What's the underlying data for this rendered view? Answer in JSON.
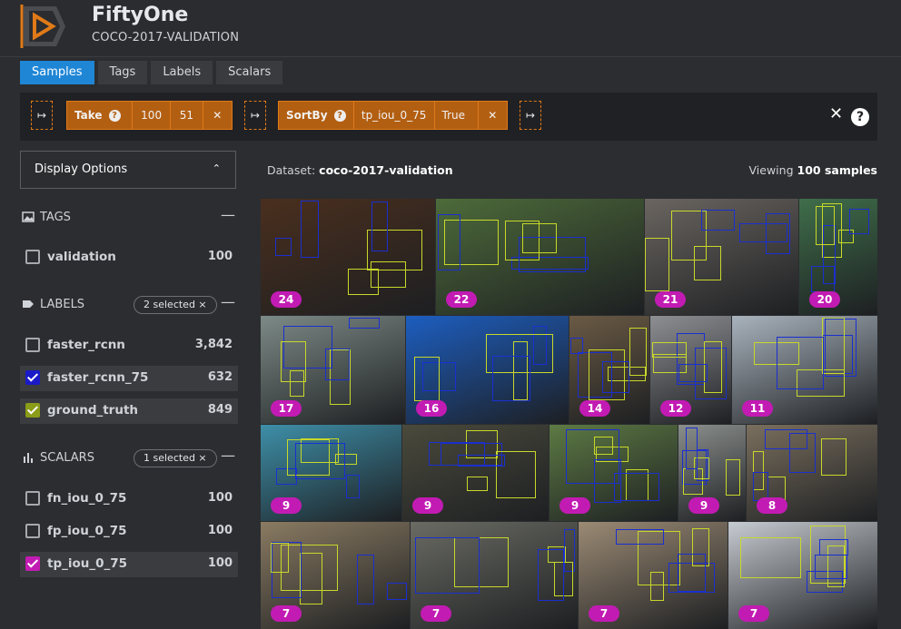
{
  "app": {
    "title": "FiftyOne",
    "subtitle": "COCO-2017-VALIDATION"
  },
  "tabs": [
    {
      "label": "Samples",
      "active": true
    },
    {
      "label": "Tags",
      "active": false
    },
    {
      "label": "Labels",
      "active": false
    },
    {
      "label": "Scalars",
      "active": false
    }
  ],
  "stages": {
    "add_glyph": "↦",
    "take": {
      "name": "Take",
      "help": "?",
      "size": "100",
      "seed": "51",
      "remove": "✕"
    },
    "sortby": {
      "name": "SortBy",
      "help": "?",
      "field": "tp_iou_0_75",
      "reverse": "True",
      "remove": "✕"
    },
    "clear": "✕",
    "help": "?"
  },
  "display_options": {
    "label": "Display Options",
    "chevron": "⌃"
  },
  "tags_section": {
    "label": "TAGS",
    "collapse": "—",
    "icon": "image-icon"
  },
  "tags": [
    {
      "name": "validation",
      "count": "100",
      "checked": false
    }
  ],
  "labels_section": {
    "label": "LABELS",
    "badge": "2 selected ×",
    "collapse": "—",
    "icon": "tag-icon"
  },
  "labels": [
    {
      "name": "faster_rcnn",
      "count": "3,842",
      "checked": false,
      "color": ""
    },
    {
      "name": "faster_rcnn_75",
      "count": "632",
      "checked": true,
      "color": "#1a1ac8"
    },
    {
      "name": "ground_truth",
      "count": "849",
      "checked": true,
      "color": "#8a9c18"
    }
  ],
  "scalars_section": {
    "label": "SCALARS",
    "badge": "1 selected ×",
    "collapse": "—",
    "icon": "bar-chart-icon"
  },
  "scalars": [
    {
      "name": "fn_iou_0_75",
      "count": "100",
      "checked": false,
      "color": ""
    },
    {
      "name": "fp_iou_0_75",
      "count": "100",
      "checked": false,
      "color": ""
    },
    {
      "name": "tp_iou_0_75",
      "count": "100",
      "checked": true,
      "color": "#c21bb3"
    }
  ],
  "dataset": {
    "prefix": "Dataset:",
    "name": "coco-2017-validation"
  },
  "viewing": {
    "prefix": "Viewing",
    "count": "100 samples"
  },
  "samples": [
    {
      "tp": "24",
      "color": "#4a2f1e"
    },
    {
      "tp": "22",
      "color": "#4d6b3a"
    },
    {
      "tp": "21",
      "color": "#6a6560"
    },
    {
      "tp": "20",
      "color": "#3f6e4a"
    },
    {
      "tp": "17",
      "color": "#7d8a86"
    },
    {
      "tp": "16",
      "color": "#1d5ec0"
    },
    {
      "tp": "14",
      "color": "#6a5a44"
    },
    {
      "tp": "12",
      "color": "#8d8f93"
    },
    {
      "tp": "11",
      "color": "#a9b3bd"
    },
    {
      "tp": "9",
      "color": "#3e8fa8"
    },
    {
      "tp": "9",
      "color": "#4a4a3c"
    },
    {
      "tp": "9",
      "color": "#5d7a44"
    },
    {
      "tp": "9",
      "color": "#8b8f8c"
    },
    {
      "tp": "8",
      "color": "#7a6f5e"
    },
    {
      "tp": "7",
      "color": "#8a7b62"
    },
    {
      "tp": "7",
      "color": "#6a6b63"
    },
    {
      "tp": "7",
      "color": "#9b8a74"
    },
    {
      "tp": "7",
      "color": "#c7ccd2"
    }
  ]
}
